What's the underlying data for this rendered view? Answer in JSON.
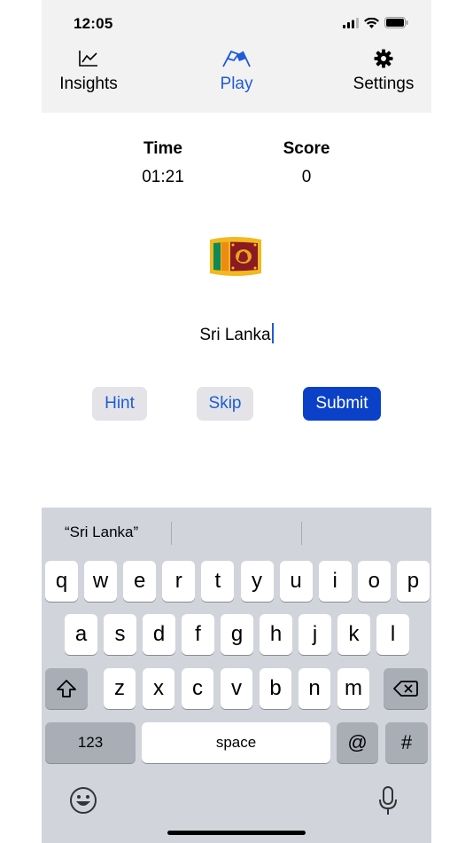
{
  "status": {
    "time": "12:05"
  },
  "tabs": [
    {
      "label": "Insights",
      "icon": "chart-line-icon"
    },
    {
      "label": "Play",
      "icon": "flags-icon",
      "active": true
    },
    {
      "label": "Settings",
      "icon": "gear-icon"
    }
  ],
  "stats": {
    "time_label": "Time",
    "time_value": "01:21",
    "score_label": "Score",
    "score_value": "0"
  },
  "flag": {
    "country_icon": "sri-lanka-flag-icon"
  },
  "answer": {
    "value": "Sri Lanka"
  },
  "buttons": {
    "hint": "Hint",
    "skip": "Skip",
    "submit": "Submit"
  },
  "keyboard": {
    "suggestion": "“Sri Lanka”",
    "row1": [
      "q",
      "w",
      "e",
      "r",
      "t",
      "y",
      "u",
      "i",
      "o",
      "p"
    ],
    "row2": [
      "a",
      "s",
      "d",
      "f",
      "g",
      "h",
      "j",
      "k",
      "l"
    ],
    "row3": [
      "z",
      "x",
      "c",
      "v",
      "b",
      "n",
      "m"
    ],
    "numbers_key": "123",
    "space_key": "space",
    "at_key": "@",
    "hash_key": "#"
  },
  "colors": {
    "accent": "#1f5bd6",
    "submit_bg": "#0a41c8",
    "keyboard_bg": "#d1d4db"
  }
}
